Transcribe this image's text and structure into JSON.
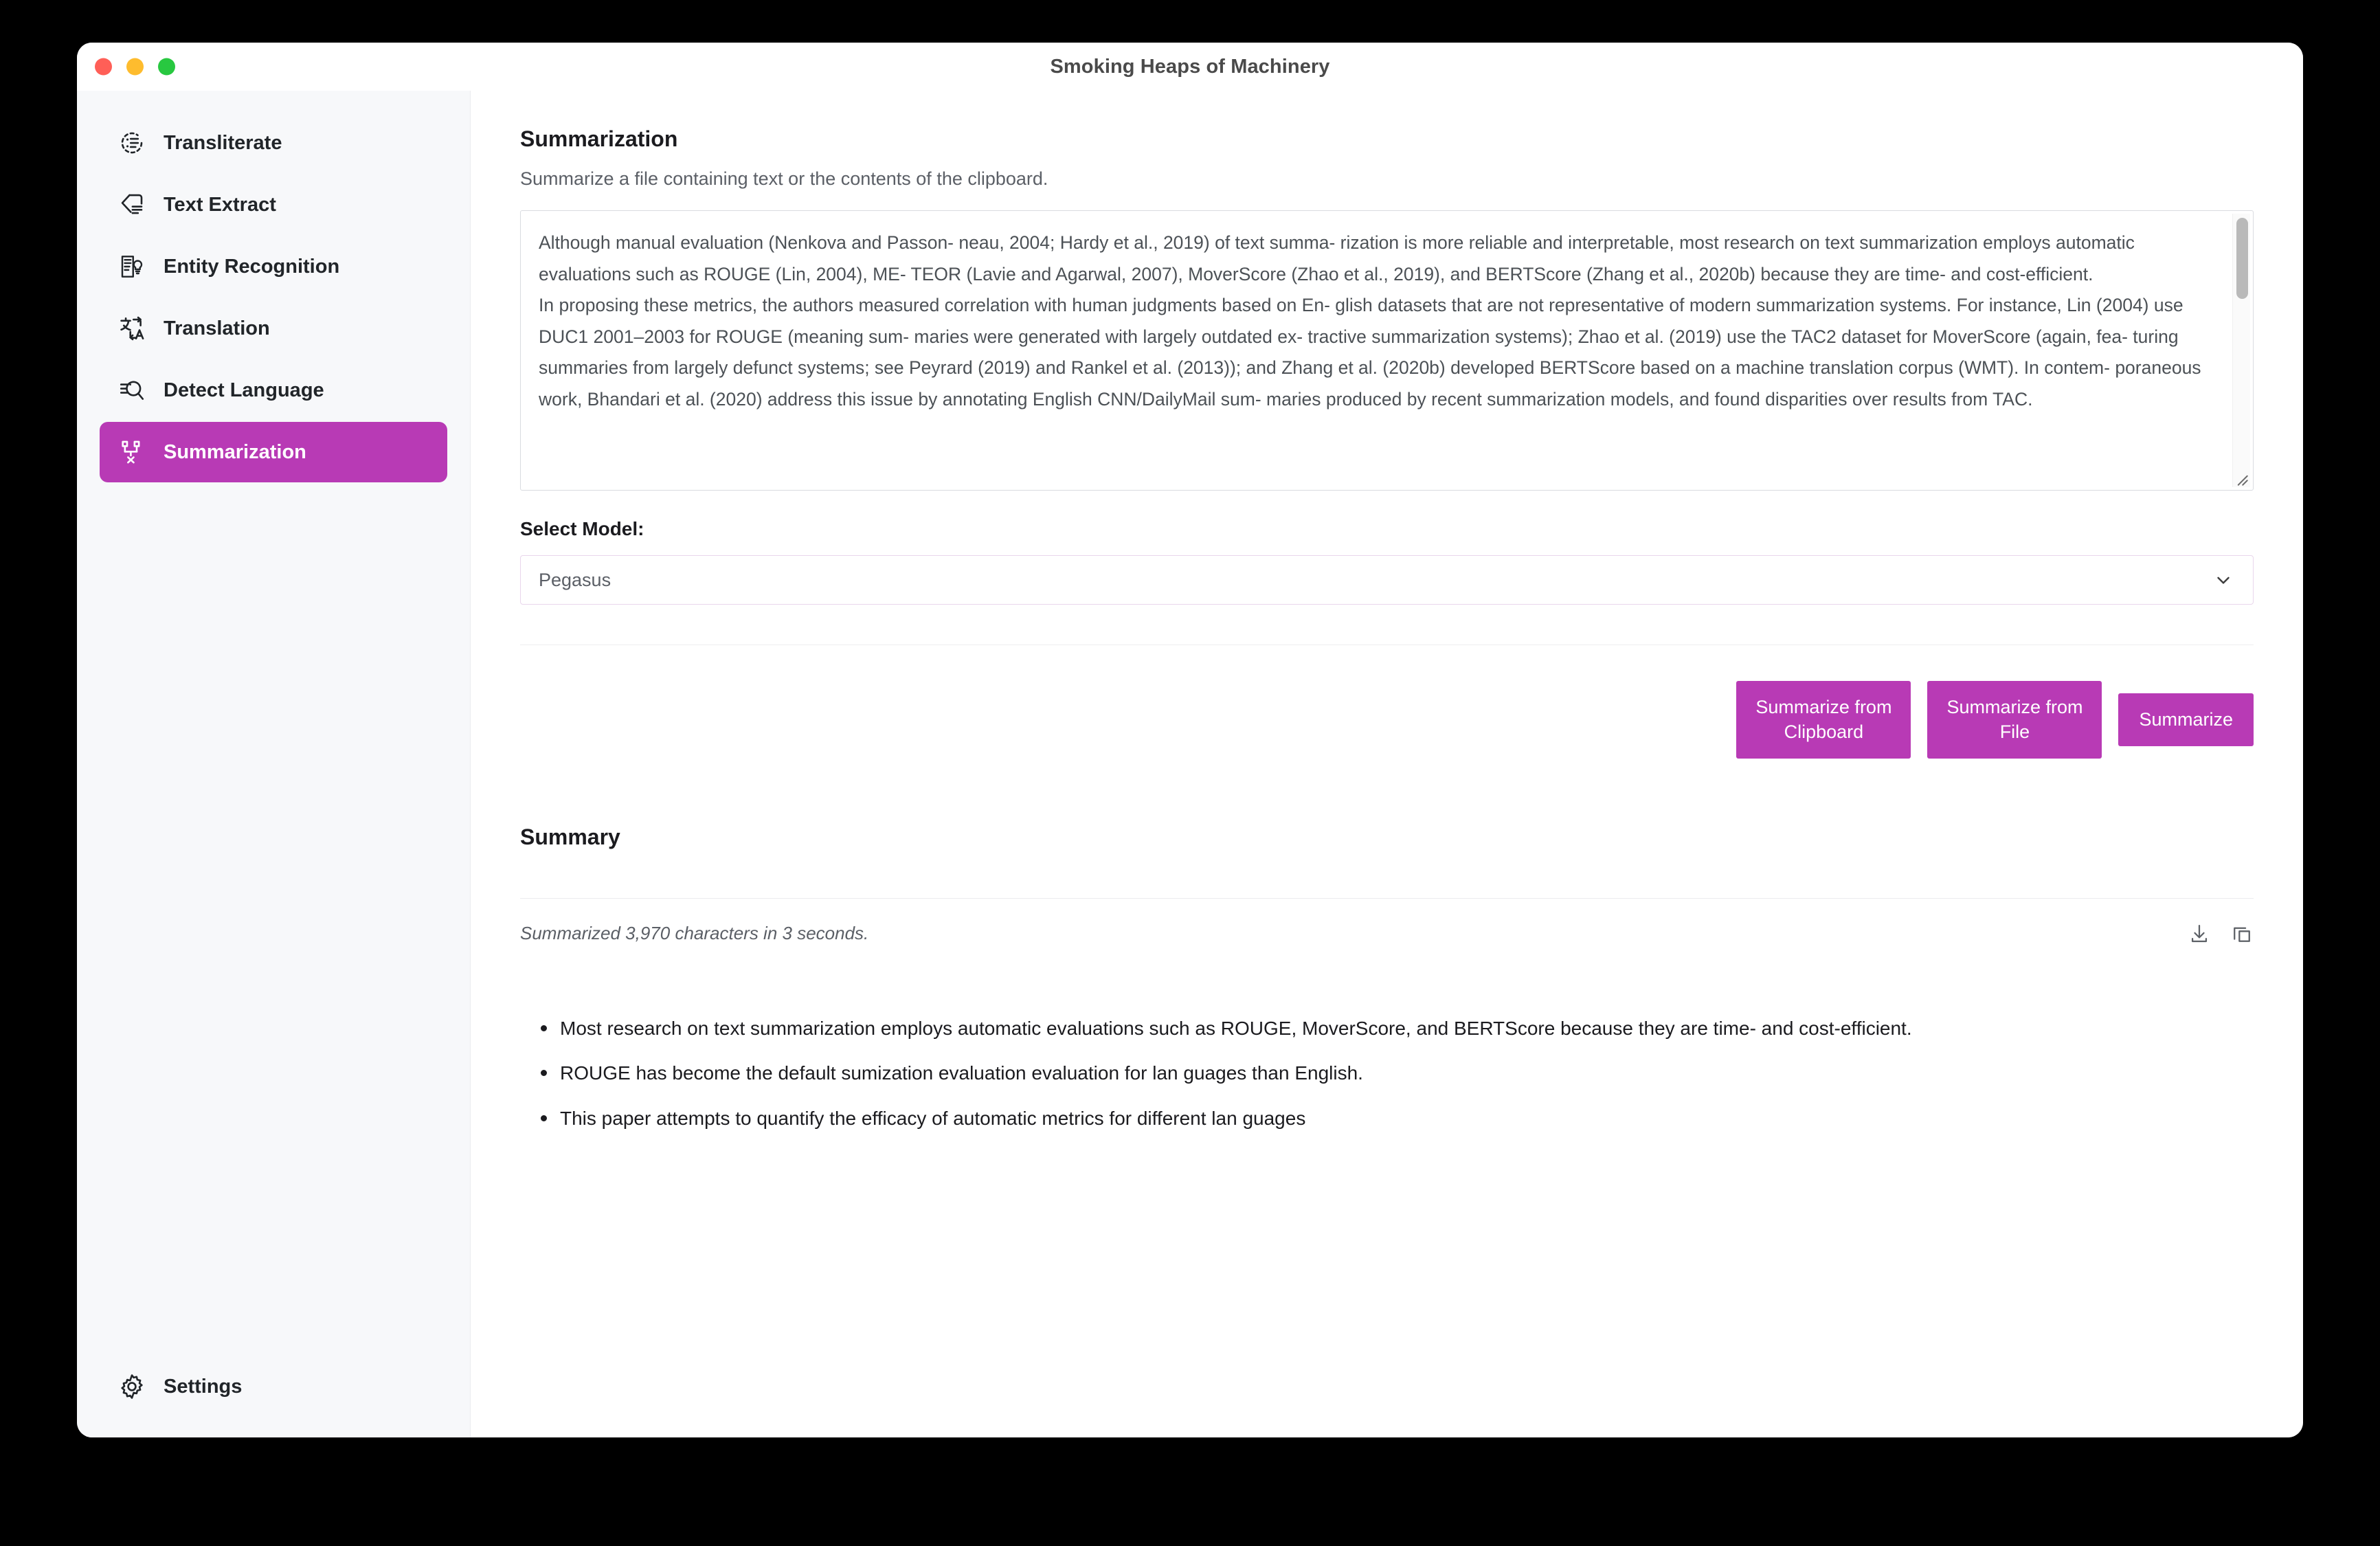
{
  "window": {
    "title": "Smoking Heaps of Machinery",
    "traffic_lights": [
      "close",
      "minimize",
      "zoom"
    ],
    "colors": {
      "accent": "#b83ab5",
      "sidebar_bg": "#f7f8fa",
      "title_text": "#4a4a4a"
    }
  },
  "sidebar": {
    "items": [
      {
        "label": "Transliterate",
        "icon": "transliterate-icon",
        "active": false
      },
      {
        "label": "Text Extract",
        "icon": "text-extract-icon",
        "active": false
      },
      {
        "label": "Entity Recognition",
        "icon": "entity-recognition-icon",
        "active": false
      },
      {
        "label": "Translation",
        "icon": "translation-icon",
        "active": false
      },
      {
        "label": "Detect Language",
        "icon": "detect-language-icon",
        "active": false
      },
      {
        "label": "Summarization",
        "icon": "summarization-icon",
        "active": true
      }
    ],
    "settings": {
      "label": "Settings",
      "icon": "gear-icon"
    }
  },
  "main": {
    "title": "Summarization",
    "subtitle": "Summarize a file containing text or the contents of the clipboard.",
    "input_text": "Although manual evaluation (Nenkova and Passon- neau, 2004; Hardy et al., 2019) of text summa- rization is more reliable and interpretable, most research on text summarization employs automatic evaluations such as ROUGE (Lin, 2004), ME- TEOR (Lavie and Agarwal, 2007), MoverScore (Zhao et al., 2019), and BERTScore (Zhang et al., 2020b) because they are time- and cost-efficient.\nIn proposing these metrics, the authors measured correlation with human judgments based on En- glish datasets that are not representative of modern summarization systems. For instance, Lin (2004) use DUC1 2001–2003 for ROUGE (meaning sum- maries were generated with largely outdated ex- tractive summarization systems); Zhao et al. (2019) use the TAC2 dataset for MoverScore (again, fea- turing summaries from largely defunct systems; see Peyrard (2019) and Rankel et al. (2013)); and Zhang et al. (2020b) developed BERTScore based on a machine translation corpus (WMT). In contem- poraneous work, Bhandari et al. (2020) address this issue by annotating English CNN/DailyMail sum- maries produced by recent summarization models, and found disparities over results from TAC.",
    "model": {
      "label": "Select Model:",
      "selected": "Pegasus",
      "chevron_icon": "chevron-down-icon"
    },
    "buttons": {
      "summarize_from_clipboard": "Summarize from\nClipboard",
      "summarize_from_file": "Summarize from\nFile",
      "summarize": "Summarize"
    },
    "summary": {
      "title": "Summary",
      "status": "Summarized 3,970 characters in 3 seconds.",
      "tools": [
        {
          "name": "download-icon"
        },
        {
          "name": "copy-icon"
        }
      ],
      "bullets": [
        "Most research on text summarization employs automatic evaluations such as ROUGE, MoverScore, and BERTScore because they are time- and cost-efficient.",
        "ROUGE has become the default sumization evaluation evaluation for lan guages than English.",
        "This paper attempts to quantify the efficacy of automatic metrics for different lan guages"
      ]
    }
  }
}
